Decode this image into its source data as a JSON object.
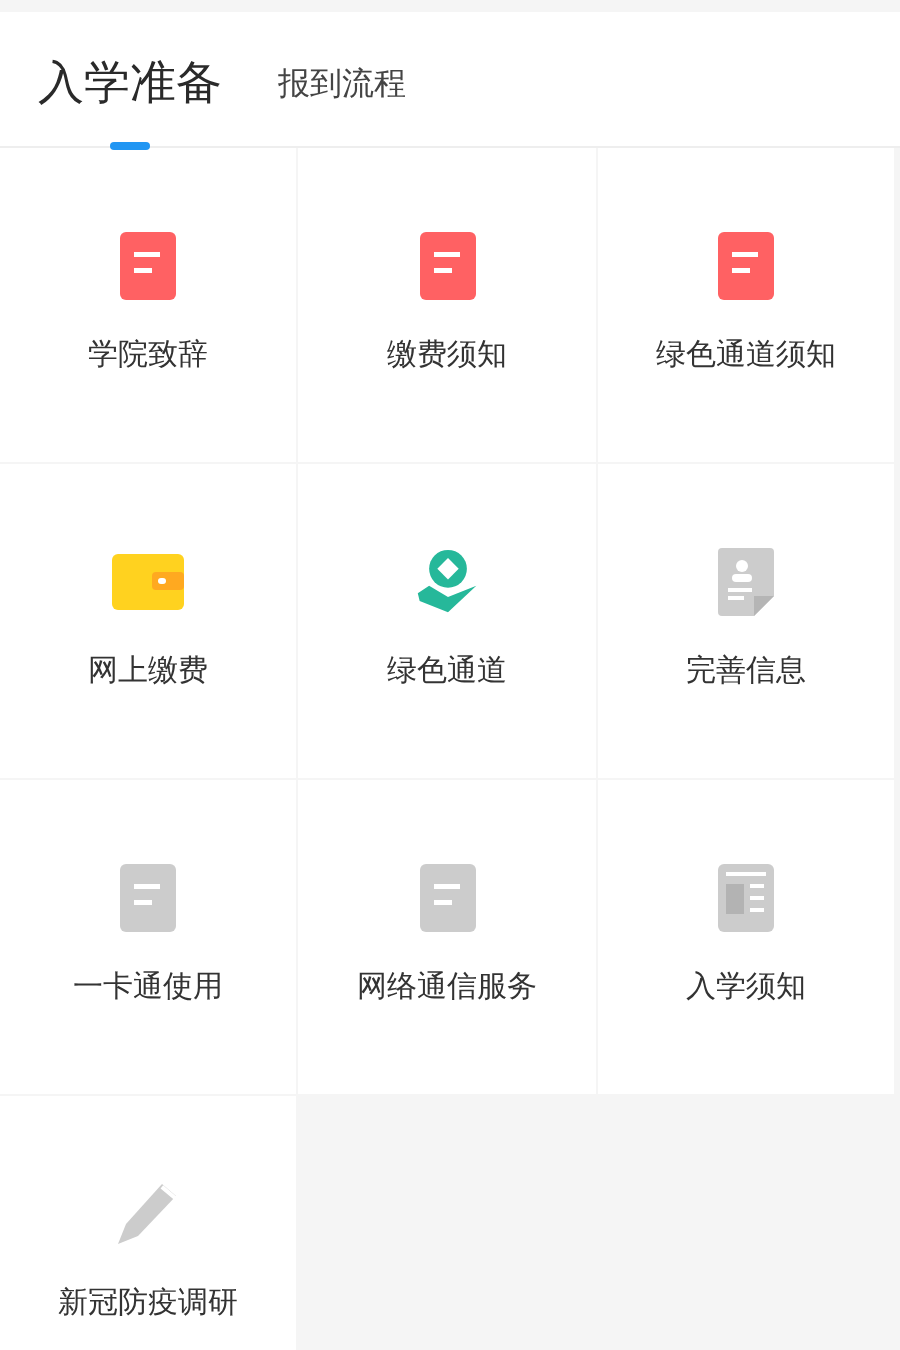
{
  "tabs": [
    {
      "label": "入学准备",
      "selected": true
    },
    {
      "label": "报到流程",
      "selected": false
    }
  ],
  "items": [
    {
      "label": "学院致辞",
      "kind": "doc",
      "color": "#ff6163"
    },
    {
      "label": "缴费须知",
      "kind": "doc",
      "color": "#ff6163"
    },
    {
      "label": "绿色通道须知",
      "kind": "doc",
      "color": "#ff6163"
    },
    {
      "label": "网上缴费",
      "kind": "wallet",
      "color": "#ffd21f"
    },
    {
      "label": "绿色通道",
      "kind": "hand",
      "color": "#26b89a"
    },
    {
      "label": "完善信息",
      "kind": "profile",
      "color": "#cccccc"
    },
    {
      "label": "一卡通使用",
      "kind": "doc",
      "color": "#cccccc"
    },
    {
      "label": "网络通信服务",
      "kind": "doc",
      "color": "#cccccc"
    },
    {
      "label": "入学须知",
      "kind": "news",
      "color": "#cccccc"
    },
    {
      "label": "新冠防疫调研",
      "kind": "pencil",
      "color": "#cccccc"
    }
  ]
}
